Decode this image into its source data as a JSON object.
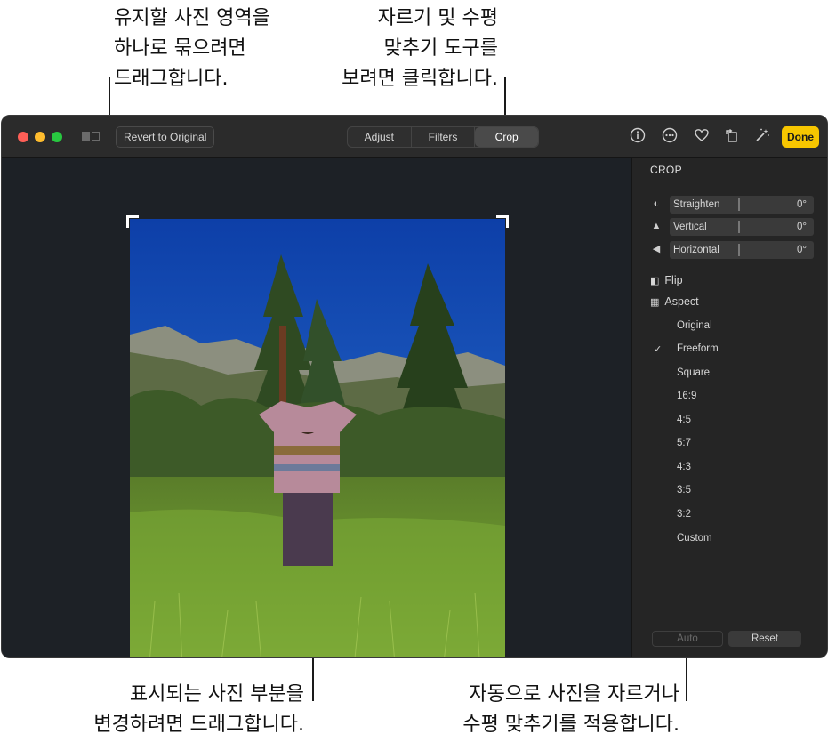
{
  "callouts": {
    "top_left": "유지할 사진 영역을\n하나로 묶으려면\n드래그합니다.",
    "top_center": "자르기 및 수평\n맞추기 도구를\n보려면 클릭합니다.",
    "bottom_left": "표시되는 사진 부분을\n변경하려면 드래그합니다.",
    "bottom_right": "자동으로 사진을 자르거나\n수평 맞추기를 적용합니다."
  },
  "toolbar": {
    "revert_label": "Revert to Original",
    "tabs": [
      {
        "label": "Adjust"
      },
      {
        "label": "Filters"
      },
      {
        "label": "Crop"
      }
    ],
    "active_tab": "Crop",
    "done_label": "Done",
    "icons": [
      "info-icon",
      "more-icon",
      "heart-icon",
      "rotate-icon",
      "magic-wand-icon"
    ]
  },
  "sidebar": {
    "title": "CROP",
    "sliders": [
      {
        "label": "Straighten",
        "value": "0°",
        "icon": "straighten-icon"
      },
      {
        "label": "Vertical",
        "value": "0°",
        "icon": "vertical-icon"
      },
      {
        "label": "Horizontal",
        "value": "0°",
        "icon": "horizontal-icon"
      }
    ],
    "flip_label": "Flip",
    "aspect_label": "Aspect",
    "aspect_options": [
      "Original",
      "Freeform",
      "Square",
      "16:9",
      "4:5",
      "5:7",
      "4:3",
      "3:5",
      "3:2",
      "Custom"
    ],
    "selected_aspect": "Freeform",
    "check_mark": "✓",
    "auto_label": "Auto",
    "reset_label": "Reset"
  },
  "colors": {
    "done": "#f7c600",
    "window_bg": "#1e1e1e",
    "sidebar_bg": "#252525"
  }
}
